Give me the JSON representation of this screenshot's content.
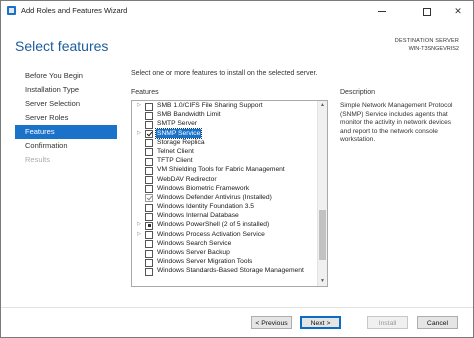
{
  "window": {
    "title": "Add Roles and Features Wizard",
    "minimize_glyph": "minimize-icon",
    "maximize_glyph": "maximize-icon",
    "close_glyph": "✕"
  },
  "header": {
    "page_title": "Select features",
    "destination_label": "DESTINATION SERVER",
    "destination_server": "WIN-T3SNGEVRIS2"
  },
  "nav": {
    "items": [
      {
        "label": "Before You Begin",
        "state": "normal"
      },
      {
        "label": "Installation Type",
        "state": "normal"
      },
      {
        "label": "Server Selection",
        "state": "normal"
      },
      {
        "label": "Server Roles",
        "state": "normal"
      },
      {
        "label": "Features",
        "state": "selected"
      },
      {
        "label": "Confirmation",
        "state": "normal"
      },
      {
        "label": "Results",
        "state": "disabled"
      }
    ]
  },
  "main": {
    "instruction": "Select one or more features to install on the selected server.",
    "features_label": "Features",
    "description_label": "Description",
    "description_text": "Simple Network Management Protocol (SNMP) Service includes agents that monitor the activity in network devices and report to the network console workstation.",
    "features": [
      {
        "label": "SMB 1.0/CIFS File Sharing Support",
        "expandable": true,
        "check": "unchecked"
      },
      {
        "label": "SMB Bandwidth Limit",
        "expandable": false,
        "check": "unchecked"
      },
      {
        "label": "SMTP Server",
        "expandable": false,
        "check": "unchecked"
      },
      {
        "label": "SNMP Service",
        "expandable": true,
        "check": "checked",
        "selected": true
      },
      {
        "label": "Storage Replica",
        "expandable": false,
        "check": "unchecked"
      },
      {
        "label": "Telnet Client",
        "expandable": false,
        "check": "unchecked"
      },
      {
        "label": "TFTP Client",
        "expandable": false,
        "check": "unchecked"
      },
      {
        "label": "VM Shielding Tools for Fabric Management",
        "expandable": false,
        "check": "unchecked"
      },
      {
        "label": "WebDAV Redirector",
        "expandable": false,
        "check": "unchecked"
      },
      {
        "label": "Windows Biometric Framework",
        "expandable": false,
        "check": "unchecked"
      },
      {
        "label": "Windows Defender Antivirus (Installed)",
        "expandable": false,
        "check": "disabled-checked"
      },
      {
        "label": "Windows Identity Foundation 3.5",
        "expandable": false,
        "check": "unchecked"
      },
      {
        "label": "Windows Internal Database",
        "expandable": false,
        "check": "unchecked"
      },
      {
        "label": "Windows PowerShell (2 of 5 installed)",
        "expandable": true,
        "check": "partial"
      },
      {
        "label": "Windows Process Activation Service",
        "expandable": true,
        "check": "unchecked"
      },
      {
        "label": "Windows Search Service",
        "expandable": false,
        "check": "unchecked"
      },
      {
        "label": "Windows Server Backup",
        "expandable": false,
        "check": "unchecked"
      },
      {
        "label": "Windows Server Migration Tools",
        "expandable": false,
        "check": "unchecked"
      },
      {
        "label": "Windows Standards-Based Storage Management",
        "expandable": false,
        "check": "unchecked"
      }
    ]
  },
  "footer": {
    "previous_label": "< Previous",
    "next_label": "Next >",
    "install_label": "Install",
    "cancel_label": "Cancel"
  },
  "scrollbar": {
    "up_icon": "▲",
    "down_icon": "▼"
  }
}
